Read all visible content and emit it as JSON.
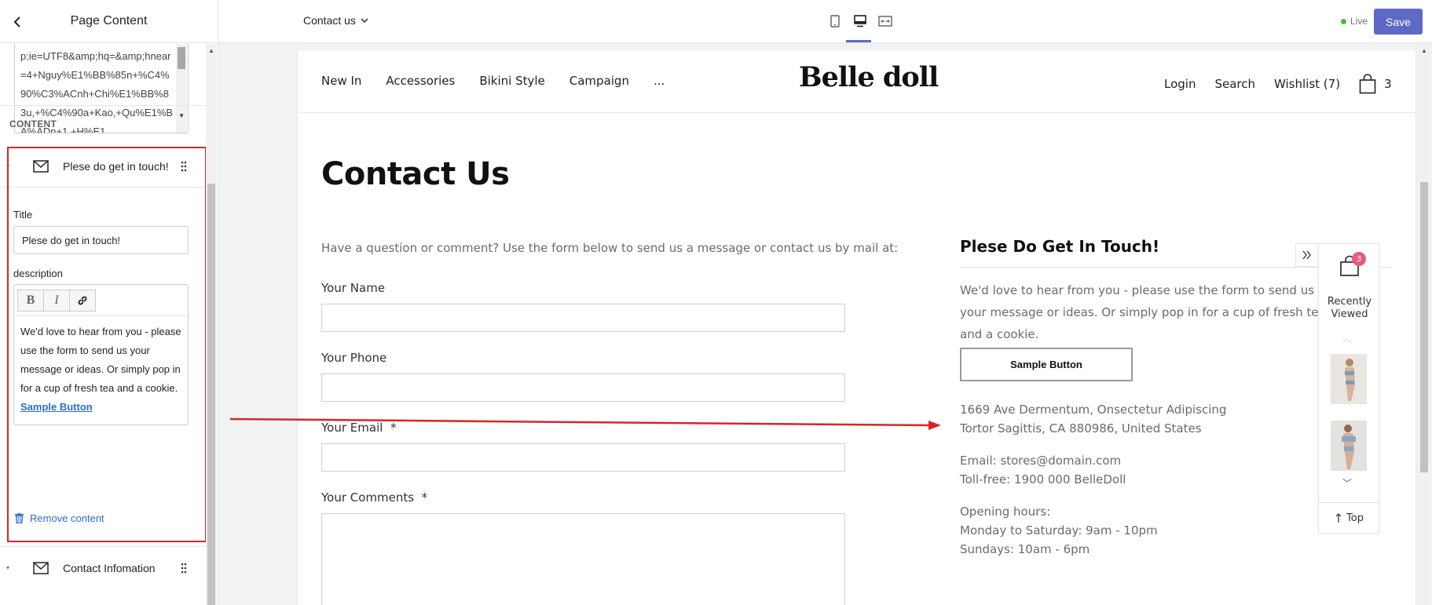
{
  "sidebar": {
    "back_label": "",
    "title": "Page Content",
    "url_text": "p;ie=UTF8&amp;hq=&amp;hnear=4+Nguy%E1%BB%85n+%C4%90%C3%ACnh+Chi%E1%BB%83u,+%C4%90a+Kao,+Qu%E1%BA%ADn+1,+H%E1",
    "section_label": "CONTENT",
    "item1_label": "Plese do get in touch!",
    "title_field_label": "Title",
    "title_value": "Plese do get in touch!",
    "description_label": "description",
    "rte": {
      "bold": "B",
      "italic": "I",
      "body": "We'd love to hear from you - please use the form to send us your message or ideas. Or simply pop in for a cup of fresh tea and a cookie.",
      "link": "Sample Button"
    },
    "remove_label": "Remove content",
    "item2_label": "Contact Infomation"
  },
  "topbar": {
    "page_select": "Contact us",
    "live_label": "Live",
    "save_label": "Save",
    "live_color": "#50b83c",
    "accent_color": "#5c6ac4"
  },
  "store": {
    "nav_left": [
      "New In",
      "Accessories",
      "Bikini Style",
      "Campaign",
      "..."
    ],
    "logo": "Belle doll",
    "nav_right": {
      "login": "Login",
      "search": "Search",
      "wishlist": "Wishlist (7)",
      "cart_count": "3"
    },
    "heading": "Contact Us",
    "intro": "Have a question or comment? Use the form below to send us a message or contact us by mail at:",
    "form": {
      "name_label": "Your Name",
      "phone_label": "Your Phone",
      "email_label": "Your Email  *",
      "comments_label": "Your Comments  *"
    },
    "touch": {
      "heading": "Plese Do Get In Touch!",
      "description": "We'd love to hear from you - please use the form to send us your message or ideas. Or simply pop in for a cup of fresh tea and a cookie.",
      "button": "Sample Button"
    },
    "info": {
      "address1": "1669 Ave Dermentum, Onsectetur Adipiscing",
      "address2": "Tortor Sagittis, CA 880986, United States",
      "email": "Email: stores@domain.com",
      "tollfree": "Toll-free: 1900 000 BelleDoll",
      "hours_title": "Opening hours:",
      "hours_week": "Monday to Saturday: 9am - 10pm",
      "hours_sunday": "Sundays: 10am - 6pm"
    },
    "recently_viewed": {
      "badge": "3",
      "title": "Recently Viewed",
      "top_label": "Top"
    }
  },
  "icons": {
    "back": "chevron-left-icon",
    "mail": "mail-icon",
    "drag": "drag-handle-icon",
    "trash": "trash-icon",
    "link": "link-icon",
    "chevron_down": "chevron-down-icon",
    "mobile": "mobile-view-icon",
    "desktop": "desktop-view-icon",
    "fullwidth": "fullwidth-view-icon",
    "bag": "shopping-bag-icon",
    "arrow_up": "arrow-up-icon"
  },
  "annotation_color": "#d7262b"
}
